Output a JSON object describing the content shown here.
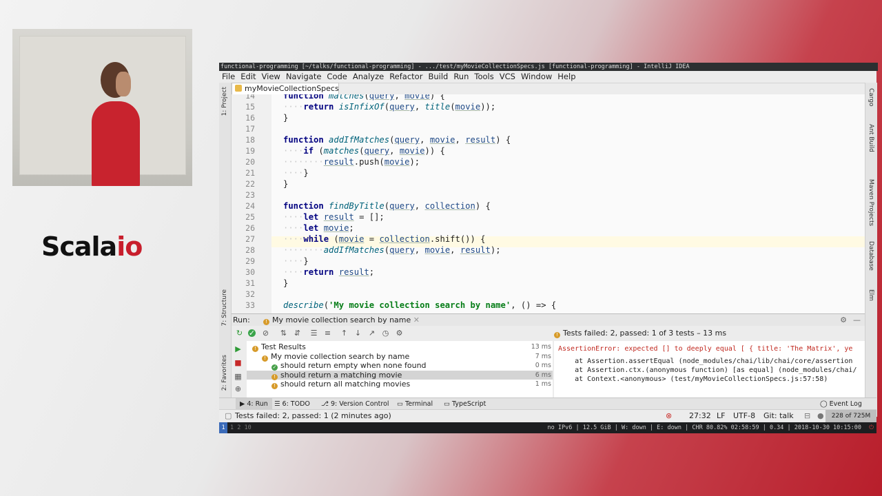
{
  "logo": {
    "text_a": "Scala",
    "text_b": "io"
  },
  "window": {
    "title": "functional-programming [~/talks/functional-programming] - .../test/myMovieCollectionSpecs.js [functional-programming] - IntelliJ IDEA"
  },
  "menu": [
    "File",
    "Edit",
    "View",
    "Navigate",
    "Code",
    "Analyze",
    "Refactor",
    "Build",
    "Run",
    "Tools",
    "VCS",
    "Window",
    "Help"
  ],
  "left_tools": [
    "1: Project",
    "7: Structure",
    "2: Favorites"
  ],
  "right_tools": [
    "Cargo",
    "Ant Build",
    "Maven Projects",
    "Database",
    "Elm"
  ],
  "editor_tab": "myMovieCollectionSpecs",
  "code_lines": [
    {
      "n": "14",
      "text": "function matches(query, movie) {"
    },
    {
      "n": "15",
      "text": "    return isInfixOf(query, title(movie));"
    },
    {
      "n": "16",
      "text": "}"
    },
    {
      "n": "17",
      "text": ""
    },
    {
      "n": "18",
      "text": "function addIfMatches(query, movie, result) {"
    },
    {
      "n": "19",
      "text": "    if (matches(query, movie)) {"
    },
    {
      "n": "20",
      "text": "        result.push(movie);"
    },
    {
      "n": "21",
      "text": "    }"
    },
    {
      "n": "22",
      "text": "}"
    },
    {
      "n": "23",
      "text": ""
    },
    {
      "n": "24",
      "text": "function findByTitle(query, collection) {"
    },
    {
      "n": "25",
      "text": "    let result = [];"
    },
    {
      "n": "26",
      "text": "    let movie;"
    },
    {
      "n": "27",
      "text": "    while (movie = collection.shift()) {"
    },
    {
      "n": "28",
      "text": "        addIfMatches(query, movie, result);"
    },
    {
      "n": "29",
      "text": "    }"
    },
    {
      "n": "30",
      "text": "    return result;"
    },
    {
      "n": "31",
      "text": "}"
    },
    {
      "n": "32",
      "text": ""
    },
    {
      "n": "33",
      "text": "describe('My movie collection search by name', () => {"
    }
  ],
  "run": {
    "label": "Run:",
    "config": "My movie collection search by name",
    "status": "Tests failed: 2, passed: 1 of 3 tests – 13 ms",
    "tree": [
      {
        "label": "Test Results",
        "time": "13 ms",
        "level": 0,
        "state": "fail"
      },
      {
        "label": "My movie collection search by name",
        "time": "7 ms",
        "level": 1,
        "state": "fail"
      },
      {
        "label": "should return empty when none found",
        "time": "0 ms",
        "level": 2,
        "state": "pass"
      },
      {
        "label": "should return a matching movie",
        "time": "6 ms",
        "level": 2,
        "state": "fail"
      },
      {
        "label": "should return all matching movies",
        "time": "1 ms",
        "level": 2,
        "state": "fail"
      }
    ],
    "output": [
      "AssertionError: expected [] to deeply equal [ { title: 'The Matrix', ye",
      "    at Assertion.assertEqual (node_modules/chai/lib/chai/core/assertion",
      "    at Assertion.ctx.(anonymous function) [as equal] (node_modules/chai/",
      "    at Context.<anonymous> (test/myMovieCollectionSpecs.js:57:58)"
    ]
  },
  "bottom_tabs": [
    "4: Run",
    "6: TODO",
    "9: Version Control",
    "Terminal",
    "TypeScript",
    "Event Log"
  ],
  "statusbar": {
    "message": "Tests failed: 2, passed: 1 (2 minutes ago)",
    "position": "27:32",
    "line_sep": "LF",
    "encoding": "UTF-8",
    "git": "Git: talk",
    "memory": "228 of 725M"
  },
  "taskbar": {
    "workspaces": "1  2  10",
    "info": "no IPv6 | 12.5 GiB | W: down | E: down | CHR 80.82% 02:58:59 | 0.34 | 2018-10-30 10:15:00"
  }
}
